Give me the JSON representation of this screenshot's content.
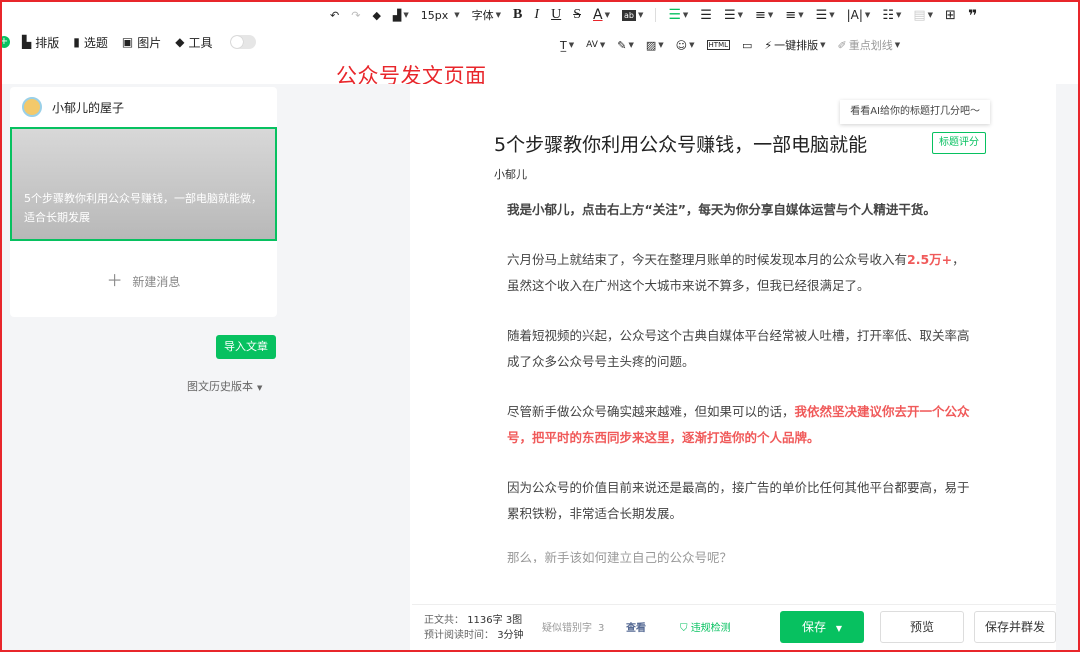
{
  "annotation": "公众号发文页面",
  "left_toolbar": {
    "items": [
      {
        "icon": "layout-icon",
        "label": "排版"
      },
      {
        "icon": "topic-icon",
        "label": "选题"
      },
      {
        "icon": "image-icon",
        "label": "图片"
      },
      {
        "icon": "tools-icon",
        "label": "工具"
      }
    ]
  },
  "editor_toolbar": {
    "font_size": "15px",
    "font_family": "字体",
    "bold": "B",
    "italic": "I",
    "underline": "U",
    "strike": "S",
    "font_color": "A",
    "one_click_layout": "一键排版",
    "key_points": "重点划线"
  },
  "account": {
    "name": "小郁儿的屋子"
  },
  "article_card": {
    "thumb_title": "5个步骤教你利用公众号赚钱，一部电脑就能做，适合长期发展",
    "new_message": "新建消息"
  },
  "import_button": "导入文章",
  "history": "图文历史版本",
  "editor": {
    "ai_tip": "看看AI给你的标题打几分吧～",
    "title": "5个步骤教你利用公众号赚钱，一部电脑就能",
    "title_score": "标题评分",
    "author": "小郁儿",
    "paragraphs": [
      {
        "text": "我是小郁儿，点击右上方“关注”，每天为你分享自媒体运营与个人精进干货。"
      },
      {
        "before": "六月份马上就结束了，今天在整理月账单的时候发现本月的公众号收入有",
        "highlight": "2.5万+",
        "after": "，虽然这个收入在广州这个大城市来说不算多，但我已经很满足了。"
      },
      {
        "text": "随着短视频的兴起，公众号这个古典自媒体平台经常被人吐槽，打开率低、取关率高成了众多公众号号主头疼的问题。"
      },
      {
        "before": "尽管新手做公众号确实越来越难，但如果可以的话，",
        "highlight": "我依然坚决建议你去开一个公众号，把平时的东西同步来这里，逐渐打造你的个人品牌。"
      },
      {
        "text": "因为公众号的价值目前来说还是最高的，接广告的单价比任何其他平台都要高，易于累积铁粉，非常适合长期发展。"
      },
      {
        "text": "那么，新手该如何建立自己的公众号呢？"
      }
    ]
  },
  "footer": {
    "word_count_label": "正文共：",
    "word_count": "1136字 3图",
    "read_time_label": "预计阅读时间：",
    "read_time": "3分钟",
    "typo_label": "疑似错别字",
    "typo_count": "3",
    "check": "查看",
    "compliance": "违规检测",
    "save": "保存",
    "preview": "预览",
    "save_publish": "保存并群发"
  },
  "colors": {
    "accent": "#07c160",
    "highlight": "#f05a5a",
    "annotation": "#e8262b"
  }
}
